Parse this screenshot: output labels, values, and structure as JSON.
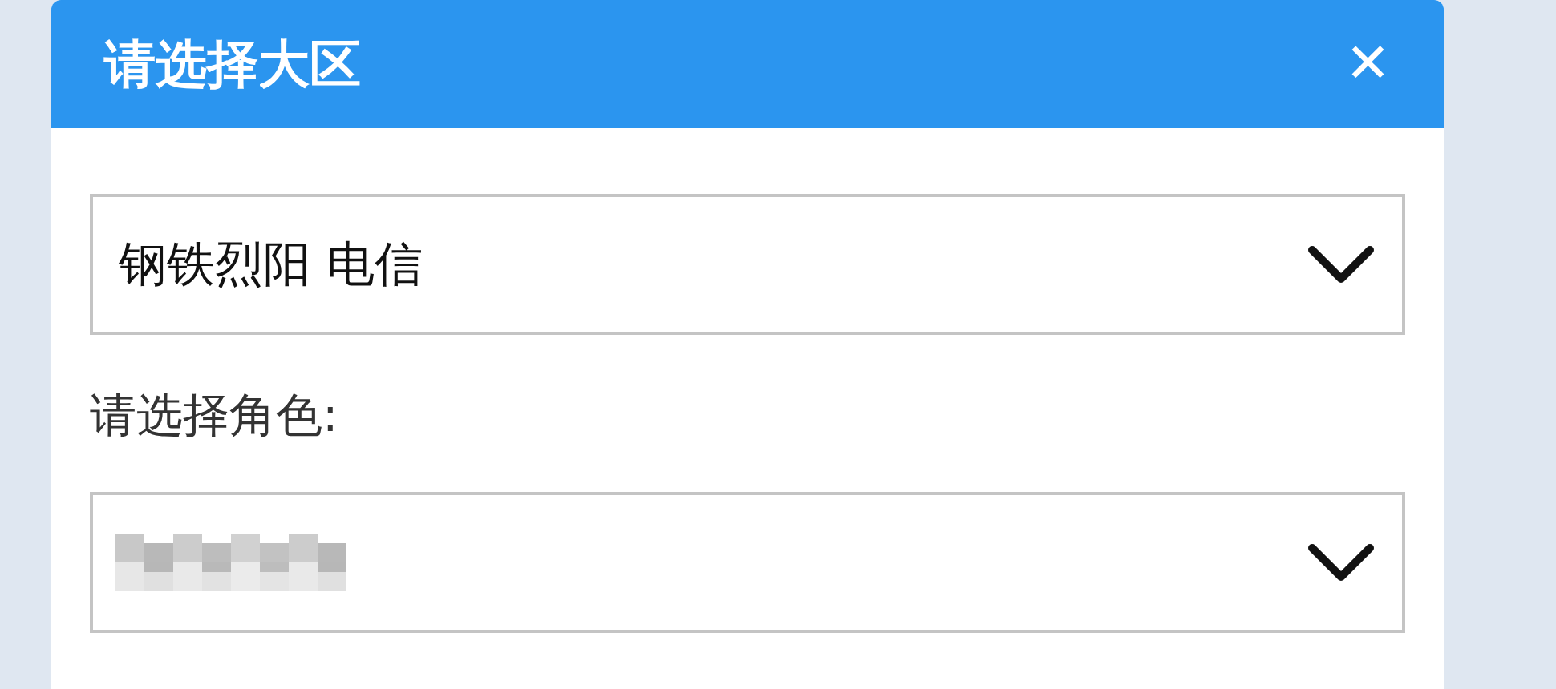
{
  "dialog": {
    "title": "请选择大区",
    "close": "✕"
  },
  "server_select": {
    "value": "钢铁烈阳 电信"
  },
  "role_label": "请选择角色:"
}
